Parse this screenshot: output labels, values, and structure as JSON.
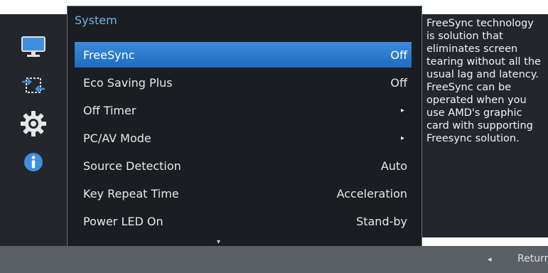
{
  "menu": {
    "title": "System",
    "items": [
      {
        "label": "FreeSync",
        "value": "Off",
        "selected": true
      },
      {
        "label": "Eco Saving Plus",
        "value": "Off"
      },
      {
        "label": "Off Timer",
        "value": "▸"
      },
      {
        "label": "PC/AV Mode",
        "value": "▸"
      },
      {
        "label": "Source Detection",
        "value": "Auto"
      },
      {
        "label": "Key Repeat Time",
        "value": "Acceleration"
      },
      {
        "label": "Power LED On",
        "value": "Stand-by"
      }
    ],
    "scroll_indicator": "▾"
  },
  "sidebar": {
    "icons": [
      "monitor-icon",
      "swap-arrows-icon",
      "gear-icon",
      "info-icon"
    ],
    "active_index": 2
  },
  "description": "FreeSync technology is solution that eliminates screen tearing without all the usual lag and latency. FreeSync can be operated when you use AMD's graphic card with supporting Freesync solution.",
  "footer": {
    "return_arrow": "◂",
    "return_label": "Return"
  },
  "colors": {
    "selected": "#2f7bd0",
    "title": "#7ab0e6",
    "background": "#1a1d21"
  }
}
